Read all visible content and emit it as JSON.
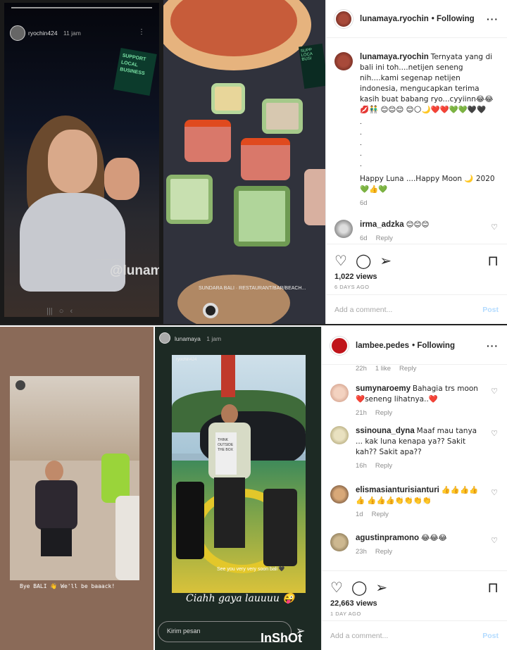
{
  "post1": {
    "username": "lunamaya.ryochin",
    "follow": "Following",
    "caption_user": "lunamaya.ryochin",
    "caption_text": "Ternyata yang di bali ini toh....netijen seneng nih....kami segenap netijen indonesia, mengucapkan terima kasih buat babang ryo...cyyiinn😂😂💋👬 😊😊😊 😊🌕🌙❤️❤️💚💚🖤🖤",
    "caption_dots": [
      ".",
      ".",
      ".",
      ".",
      "."
    ],
    "caption_tail": "Happy Luna ....Happy Moon 🌙 2020 💚👍💚",
    "caption_age": "6d",
    "comment_user": "irma_adzka",
    "comment_text": "😊😊😊",
    "comment_age": "6d",
    "comment_reply": "Reply",
    "views": "1,022 views",
    "date": "6 DAYS AGO",
    "add_comment_placeholder": "Add a comment...",
    "post_label": "Post",
    "story_user": "ryochin424",
    "story_time": "11 jam",
    "story_tag": "@lunamaya.ryochin",
    "sign_text": "SUPPORT LOCAL BUSINESS",
    "restaurant_text": "SUNDARA BALI · RESTAURANT/BAR/BEACH..."
  },
  "post2": {
    "username": "lambee.pedes",
    "follow": "Following",
    "top_meta": [
      "22h",
      "1 like",
      "Reply"
    ],
    "comments": [
      {
        "user": "sumynaroemy",
        "text": "Bahagia trs moon ❤️seneng lihatnya..❤️",
        "age": "21h",
        "reply": "Reply"
      },
      {
        "user": "ssinouna_dyna",
        "text": "Maaf mau tanya ... kak luna kenapa ya?? Sakit kah?? Sakit apa??",
        "age": "16h",
        "reply": "Reply"
      },
      {
        "user": "elismasianturisianturi",
        "text": "👍👍👍👍👍 👍👍👍👏👏👏👏",
        "age": "1d",
        "reply": "Reply"
      },
      {
        "user": "agustinpramono",
        "text": "😂😂😂",
        "age": "23h",
        "reply": "Reply"
      }
    ],
    "views": "22,663 views",
    "date": "1 DAY AGO",
    "add_comment_placeholder": "Add a comment...",
    "post_label": "Post",
    "story_user": "lunamaya",
    "story_time": "1 jam",
    "inner_story_user": "ryochin424",
    "story_caption_1": "Bye BALI 👋 We'll be baaack!",
    "story_caption_2": "See you very very soon bali 🖤",
    "story_caption_3": "Ciahh gaya lauuuu 😜",
    "kirim_pesan": "Kirim pesan",
    "watermark": "InShOt",
    "bag_text": "THINK OUTSIDE THE BOX"
  }
}
